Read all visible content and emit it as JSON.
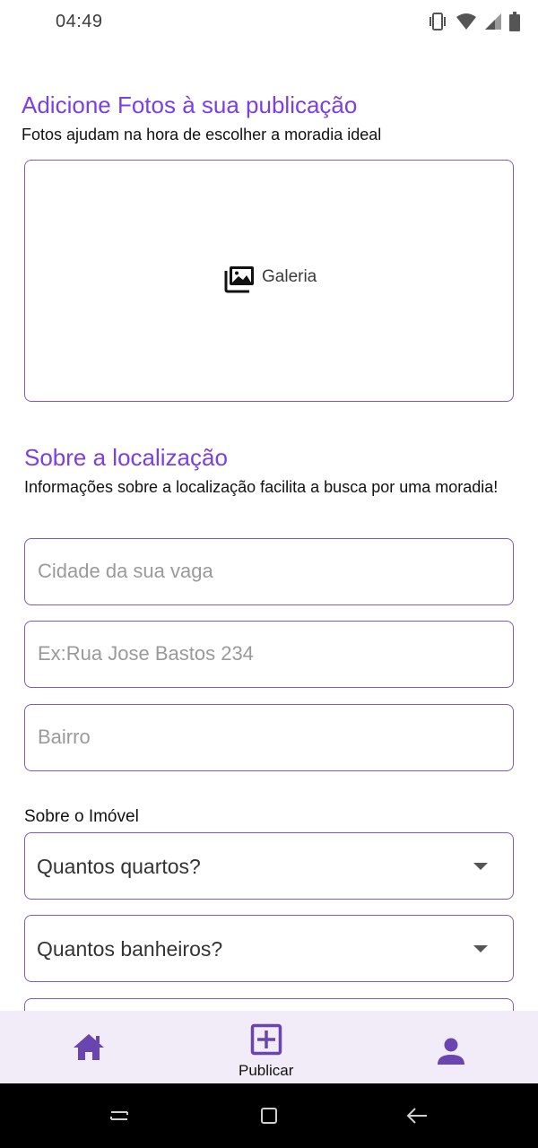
{
  "status_bar": {
    "time": "04:49",
    "icons": [
      "vibrate-icon",
      "wifi-icon",
      "signal-icon",
      "battery-icon"
    ]
  },
  "photos": {
    "title": "Adicione Fotos à sua publicação",
    "subtitle": "Fotos ajudam na hora de escolher a moradia ideal",
    "gallery_button": {
      "icon": "gallery-icon",
      "label": "Galeria"
    }
  },
  "location": {
    "title": "Sobre a localização",
    "subtitle": "Informações sobre a localização facilita a busca por uma moradia!",
    "city_placeholder": "Cidade da sua vaga",
    "street_placeholder": "Ex:Rua Jose Bastos 234",
    "district_placeholder": "Bairro"
  },
  "property": {
    "label": "Sobre o Imóvel",
    "bedrooms_select": "Quantos quartos?",
    "bathrooms_select": "Quantos banheiros?"
  },
  "bottom_nav": {
    "home_icon": "home-icon",
    "publish_icon": "add-box-icon",
    "publish_label": "Publicar",
    "profile_icon": "person-icon"
  },
  "system_nav": [
    "recents-icon",
    "home-square-icon",
    "back-icon"
  ],
  "colors": {
    "accent": "#7b3fe4",
    "border": "#7e5bc4",
    "nav_icon": "#6a45b0",
    "bottom_nav_bg": "#f1ecf8"
  }
}
